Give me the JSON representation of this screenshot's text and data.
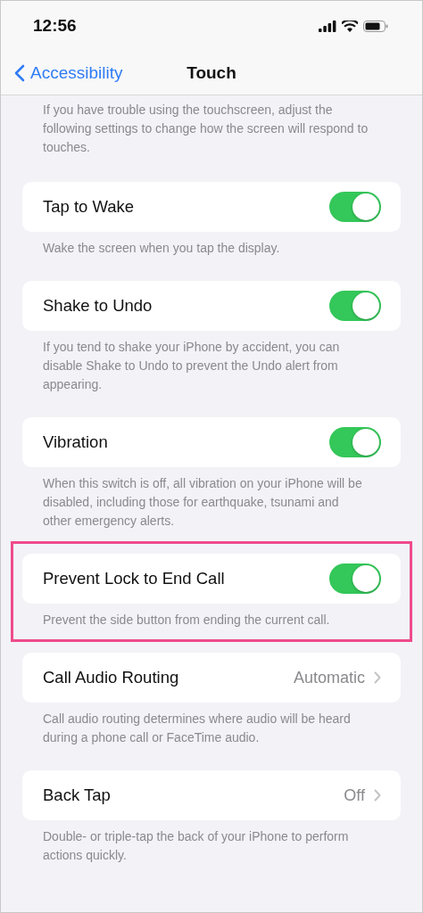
{
  "status_bar": {
    "time": "12:56"
  },
  "nav": {
    "back": "Accessibility",
    "title": "Touch"
  },
  "intro": "If you have trouble using the touchscreen, adjust the following settings to change how the screen will respond to touches.",
  "sections": [
    {
      "kind": "toggle",
      "label": "Tap to Wake",
      "on": true,
      "highlighted": false,
      "footer": "Wake the screen when you tap the display."
    },
    {
      "kind": "toggle",
      "label": "Shake to Undo",
      "on": true,
      "highlighted": false,
      "footer": "If you tend to shake your iPhone by accident, you can disable Shake to Undo to prevent the Undo alert from appearing."
    },
    {
      "kind": "toggle",
      "label": "Vibration",
      "on": true,
      "highlighted": false,
      "footer": "When this switch is off, all vibration on your iPhone will be disabled, including those for earthquake, tsunami and other emergency alerts."
    },
    {
      "kind": "toggle",
      "label": "Prevent Lock to End Call",
      "on": true,
      "highlighted": true,
      "footer": "Prevent the side button from ending the current call."
    },
    {
      "kind": "value",
      "label": "Call Audio Routing",
      "value": "Automatic",
      "highlighted": false,
      "footer": "Call audio routing determines where audio will be heard during a phone call or FaceTime audio."
    },
    {
      "kind": "value",
      "label": "Back Tap",
      "value": "Off",
      "highlighted": false,
      "footer": "Double- or triple-tap the back of your iPhone to perform actions quickly."
    }
  ]
}
